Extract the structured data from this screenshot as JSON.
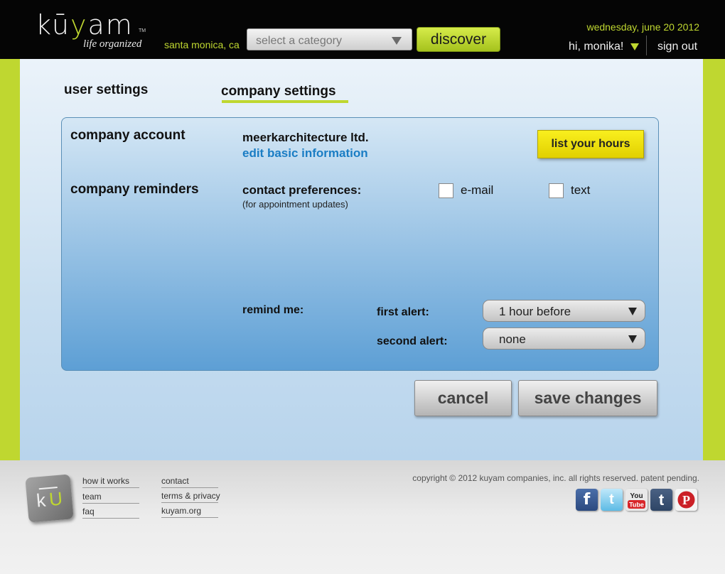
{
  "header": {
    "logo_word_a": "k",
    "logo_word_b": "ū",
    "logo_word_c": "y",
    "logo_word_d": "am",
    "logo_tm": "TM",
    "tagline": "life organized",
    "location": "santa monica, ca",
    "category_placeholder": "select a category",
    "discover_label": "discover",
    "date": "wednesday, june 20 2012",
    "greeting": "hi, monika!",
    "signout_label": "sign out"
  },
  "tabs": {
    "user_settings": "user settings",
    "company_settings": "company settings",
    "active": "company_settings"
  },
  "company_account": {
    "title": "company account",
    "company_name": "meerkarchitecture ltd.",
    "edit_link": "edit basic information",
    "hours_button": "list your hours"
  },
  "company_reminders": {
    "title": "company reminders",
    "contact_label": "contact preferences:",
    "contact_sub": "(for appointment updates)",
    "options": [
      {
        "label": "e-mail",
        "checked": false
      },
      {
        "label": "text",
        "checked": false
      }
    ],
    "remind_label": "remind me:",
    "first_alert_label": "first alert:",
    "first_alert_value": "1 hour before",
    "second_alert_label": "second alert:",
    "second_alert_value": "none"
  },
  "actions": {
    "cancel": "cancel",
    "save": "save changes"
  },
  "footer": {
    "logo_k": "k",
    "logo_u": "U",
    "links_col1": [
      "how it works",
      "team",
      "faq"
    ],
    "links_col2": [
      "contact",
      "terms & privacy",
      "kuyam.org"
    ],
    "copyright": "copyright © 2012 kuyam companies, inc. all rights reserved. patent pending.",
    "social": [
      {
        "name": "facebook",
        "glyph": "f"
      },
      {
        "name": "twitter",
        "glyph": "t"
      },
      {
        "name": "youtube",
        "glyph": "You Tube"
      },
      {
        "name": "tumblr",
        "glyph": "t"
      },
      {
        "name": "pinterest",
        "glyph": "P"
      }
    ]
  },
  "colors": {
    "accent_green": "#bfd730",
    "link_blue": "#1a7dc4",
    "hours_yellow": "#f2e300"
  }
}
